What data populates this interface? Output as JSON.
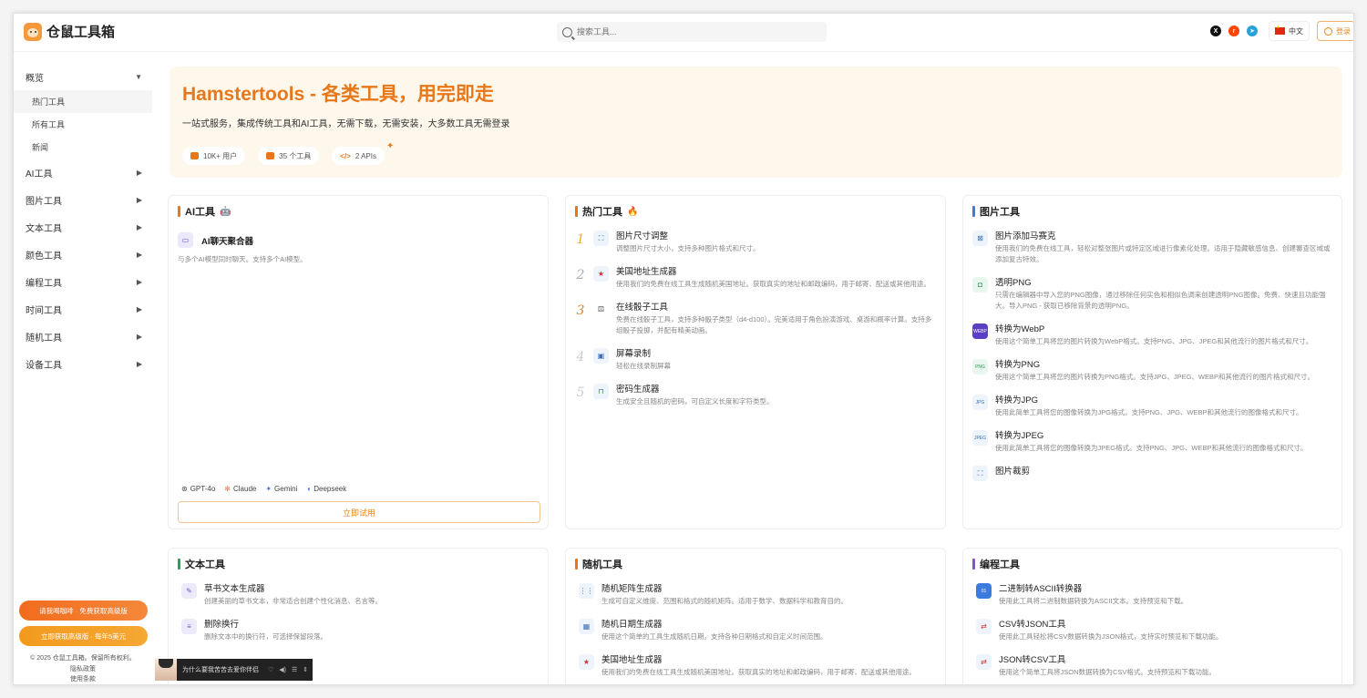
{
  "header": {
    "logo_text": "仓鼠工具箱",
    "search_placeholder": "搜索工具...",
    "lang_label": "中文",
    "login_label": "登录"
  },
  "sidebar": {
    "overview": "概览",
    "sub_items": [
      "热门工具",
      "所有工具",
      "新闻"
    ],
    "categories": [
      "AI工具",
      "图片工具",
      "文本工具",
      "颜色工具",
      "编程工具",
      "时间工具",
      "随机工具",
      "设备工具"
    ],
    "promo_1": "请我喝咖啡 · 免费获取高级版",
    "promo_2": "立即获取高级版 · 每年5美元",
    "copyright": "© 2025 仓鼠工具箱。保留所有权利。",
    "privacy": "隐私政策",
    "terms": "使用条款"
  },
  "hero": {
    "title": "Hamstertools - 各类工具，用完即走",
    "subtitle": "一站式服务，集成传统工具和AI工具，无需下载，无需安装，大多数工具无需登录",
    "stats": [
      "10K+ 用户",
      "35 个工具",
      "2 APIs"
    ]
  },
  "ai_card": {
    "title": "AI工具",
    "tool_name": "AI聊天聚合器",
    "tool_desc": "与多个AI模型同时聊天。支持多个AI模型。",
    "models": [
      "GPT-4o",
      "Claude",
      "Gemini",
      "Deepseek"
    ],
    "try_label": "立即试用"
  },
  "hot_card": {
    "title": "热门工具",
    "items": [
      {
        "rank": "1",
        "name": "图片尺寸调整",
        "desc": "调整图片尺寸大小，支持多种图片格式和尺寸。"
      },
      {
        "rank": "2",
        "name": "美国地址生成器",
        "desc": "使用我们的免费在线工具生成随机美国地址。获取真实的地址和邮政编码，用于邮寄、配送或其他用途。"
      },
      {
        "rank": "3",
        "name": "在线骰子工具",
        "desc": "免费在线骰子工具，支持多种骰子类型（d4-d100）。完美适用于角色扮演游戏、桌游和概率计算。支持多组骰子投掷，并配有精美动画。"
      },
      {
        "rank": "4",
        "name": "屏幕录制",
        "desc": "轻松在线录制屏幕"
      },
      {
        "rank": "5",
        "name": "密码生成器",
        "desc": "生成安全且随机的密码，可自定义长度和字符类型。"
      }
    ]
  },
  "image_card": {
    "title": "图片工具",
    "items": [
      {
        "name": "图片添加马赛克",
        "desc": "使用我们的免费在线工具，轻松对整张图片或特定区域进行像素化处理。适用于隐藏敏感信息、创建審查区域或添加复古特效。"
      },
      {
        "name": "透明PNG",
        "desc": "只需在编辑器中导入您的PNG图像，通过移除任何实色和相似色调来创建透明PNG图像。免费、快速且功能强大。导入PNG - 获取已移除背景的透明PNG。"
      },
      {
        "name": "转换为WebP",
        "desc": "使用这个简单工具将您的图片转换为WebP格式。支持PNG、JPG、JPEG和其他流行的图片格式和尺寸。"
      },
      {
        "name": "转换为PNG",
        "desc": "使用这个简单工具将您的图片转换为PNG格式。支持JPG、JPEG、WEBP和其他流行的图片格式和尺寸。"
      },
      {
        "name": "转换为JPG",
        "desc": "使用此简单工具将您的图像转换为JPG格式。支持PNG、JPG、WEBP和其他流行的图像格式和尺寸。"
      },
      {
        "name": "转换为JPEG",
        "desc": "使用此简单工具将您的图像转换为JPEG格式。支持PNG、JPG、WEBP和其他流行的图像格式和尺寸。"
      },
      {
        "name": "图片裁剪",
        "desc": ""
      }
    ]
  },
  "text_card": {
    "title": "文本工具",
    "items": [
      {
        "name": "草书文本生成器",
        "desc": "创建美丽的草书文本，非常适合创建个性化消息、名言等。"
      },
      {
        "name": "删除换行",
        "desc": "删除文本中的换行符，可选择保留段落。"
      }
    ]
  },
  "random_card": {
    "title": "随机工具",
    "items": [
      {
        "name": "随机矩阵生成器",
        "desc": "生成可自定义维度、范围和格式的随机矩阵。适用于数学、数据科学和教育目的。"
      },
      {
        "name": "随机日期生成器",
        "desc": "使用这个简单的工具生成随机日期。支持各种日期格式和自定义时间范围。"
      },
      {
        "name": "美国地址生成器",
        "desc": "使用我们的免费在线工具生成随机美国地址。获取真实的地址和邮政编码，用于邮寄、配送或其他用途。"
      }
    ]
  },
  "code_card": {
    "title": "编程工具",
    "items": [
      {
        "name": "二进制转ASCII转换器",
        "desc": "使用此工具将二进制数据转换为ASCII文本。支持预览和下载。"
      },
      {
        "name": "CSV转JSON工具",
        "desc": "使用此工具轻松将CSV数据转换为JSON格式，支持实时预览和下载功能。"
      },
      {
        "name": "JSON转CSV工具",
        "desc": "使用这个简单工具将JSON数据转换为CSV格式。支持预览和下载功能。"
      }
    ]
  },
  "player": {
    "song": "为什么要我苦苦去爱你伴侣"
  },
  "colors": {
    "accent": "#e8771a",
    "hero_bg": "#fef7ec"
  }
}
